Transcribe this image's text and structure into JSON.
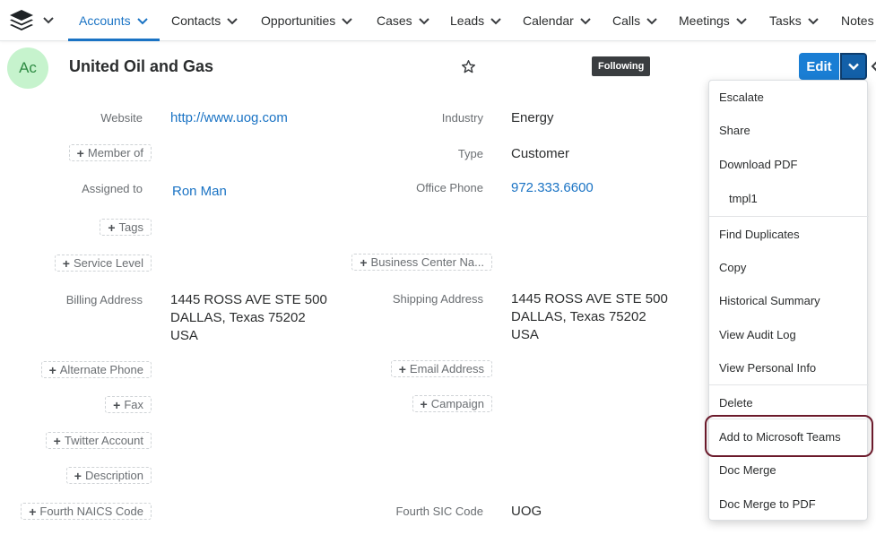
{
  "nav": {
    "items": [
      {
        "label": "Accounts",
        "active": true
      },
      {
        "label": "Contacts"
      },
      {
        "label": "Opportunities"
      },
      {
        "label": "Cases"
      },
      {
        "label": "Leads"
      },
      {
        "label": "Calendar"
      },
      {
        "label": "Calls"
      },
      {
        "label": "Meetings"
      },
      {
        "label": "Tasks"
      },
      {
        "label": "Notes"
      }
    ],
    "accent_color": "#1a73c4"
  },
  "record": {
    "avatar_initials": "Ac",
    "name": "United Oil and Gas",
    "following_label": "Following",
    "edit_label": "Edit"
  },
  "fields": {
    "website_label": "Website",
    "website_value": "http://www.uog.com",
    "industry_label": "Industry",
    "industry_value": "Energy",
    "member_of": "Member of",
    "type_label": "Type",
    "type_value": "Customer",
    "assigned_to_label": "Assigned to",
    "assigned_to_value": "Ron Man",
    "office_phone_label": "Office Phone",
    "office_phone_value": "972.333.6600",
    "tags": "Tags",
    "service_level": "Service Level",
    "business_center": "Business Center Na...",
    "billing_address_label": "Billing Address",
    "billing_address_lines": [
      "1445 ROSS AVE STE 500",
      "DALLAS, Texas 75202",
      "USA"
    ],
    "shipping_address_label": "Shipping Address",
    "shipping_address_lines": [
      "1445 ROSS AVE STE 500",
      "DALLAS, Texas 75202",
      "USA"
    ],
    "alternate_phone": "Alternate Phone",
    "email_address": "Email Address",
    "fax": "Fax",
    "campaign": "Campaign",
    "twitter_account": "Twitter Account",
    "description": "Description",
    "fourth_naics": "Fourth NAICS Code",
    "fourth_sic_label": "Fourth SIC Code",
    "fourth_sic_value": "UOG"
  },
  "menu": {
    "items": [
      "Escalate",
      "Share",
      "Download PDF",
      "tmpl1",
      "Find Duplicates",
      "Copy",
      "Historical Summary",
      "View Audit Log",
      "View Personal Info",
      "Delete",
      "Add to Microsoft Teams",
      "Doc Merge",
      "Doc Merge to PDF"
    ],
    "highlighted": "Add to Microsoft Teams"
  }
}
